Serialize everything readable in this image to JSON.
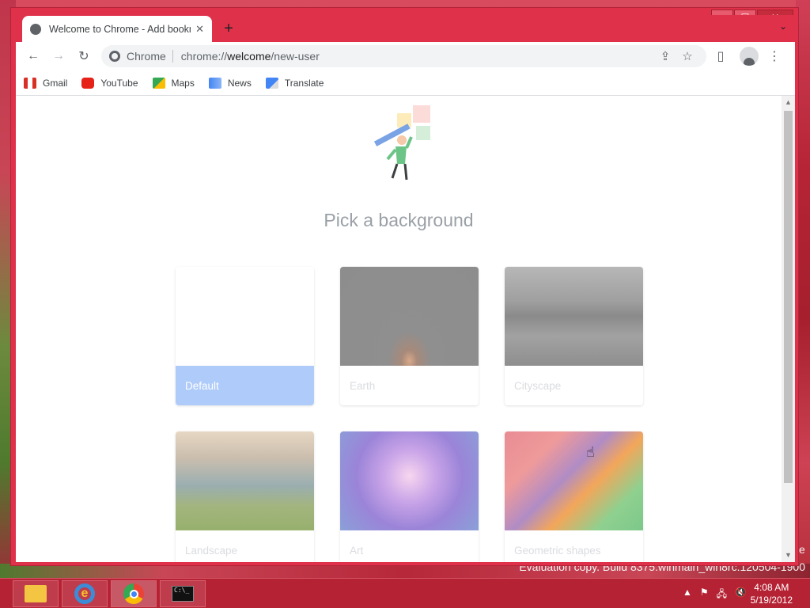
{
  "window": {
    "controls": {
      "minimize": "▁",
      "maximize": "☐",
      "close": "✕"
    }
  },
  "tab": {
    "title": "Welcome to Chrome - Add bookmarks",
    "close": "✕",
    "new_tab": "+",
    "tab_search": "⌄"
  },
  "toolbar": {
    "back": "←",
    "forward": "→",
    "reload": "↻",
    "site_label": "Chrome",
    "url_scheme": "chrome://",
    "url_host": "welcome",
    "url_path": "/new-user",
    "share": "⇪",
    "bookmark_star": "☆",
    "side_panel": "▯",
    "menu": "⋮"
  },
  "bookmarks": [
    {
      "label": "Gmail",
      "icon": "gmail-icon"
    },
    {
      "label": "YouTube",
      "icon": "youtube-icon"
    },
    {
      "label": "Maps",
      "icon": "maps-icon"
    },
    {
      "label": "News",
      "icon": "news-icon"
    },
    {
      "label": "Translate",
      "icon": "translate-icon"
    }
  ],
  "page": {
    "heading": "Pick a background",
    "backgrounds": [
      {
        "label": "Default",
        "selected": true
      },
      {
        "label": "Earth"
      },
      {
        "label": "Cityscape"
      },
      {
        "label": "Landscape"
      },
      {
        "label": "Art"
      },
      {
        "label": "Geometric shapes"
      }
    ]
  },
  "desktop": {
    "watermark": "Evaluation copy. Build 8375.winmain_win8rc.120504-1900",
    "watermark_e": "e"
  },
  "taskbar": {
    "apps": [
      "File Explorer",
      "Internet Explorer",
      "Google Chrome",
      "Command Prompt"
    ],
    "tray": {
      "show_hidden": "▲",
      "flag": "⚑",
      "network": "🖧",
      "volume": "🔇"
    },
    "time": "4:08 AM",
    "date": "5/19/2012"
  }
}
